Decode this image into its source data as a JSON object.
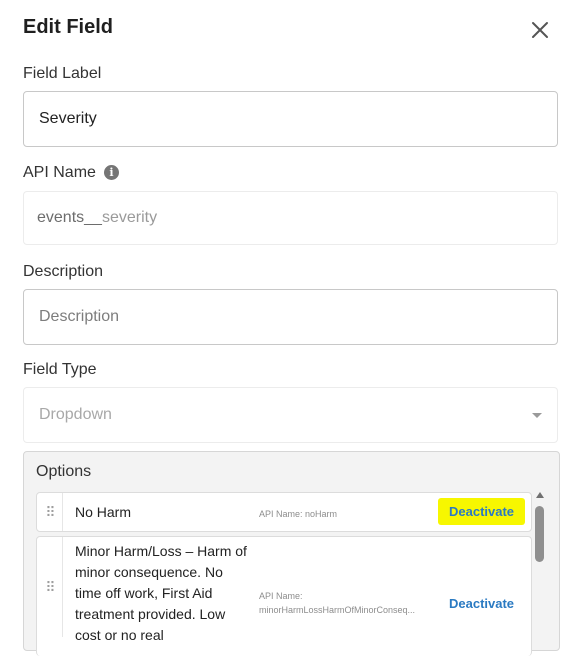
{
  "header": {
    "title": "Edit Field",
    "close_icon": "close-icon"
  },
  "field_label": {
    "label": "Field Label",
    "value": "Severity"
  },
  "api_name": {
    "label": "API Name",
    "info_icon": "info-icon",
    "value_prefix": "events__",
    "value_suffix": "severity"
  },
  "description": {
    "label": "Description",
    "placeholder": "Description",
    "value": ""
  },
  "field_type": {
    "label": "Field Type",
    "value": "Dropdown",
    "caret_icon": "caret-down-icon"
  },
  "options": {
    "label": "Options",
    "items": [
      {
        "label": "No Harm",
        "api_label": "API Name: noHarm",
        "action": "Deactivate"
      },
      {
        "label": "Minor Harm/Loss – Harm of minor consequence. No time off work, First Aid treatment provided. Low cost or no real",
        "api_label_line1": "API Name:",
        "api_label_line2": "minorHarmLossHarmOfMinorConseq...",
        "action": "Deactivate"
      }
    ]
  },
  "colors": {
    "highlight": "#f7f700",
    "link": "#2a7ac2"
  }
}
